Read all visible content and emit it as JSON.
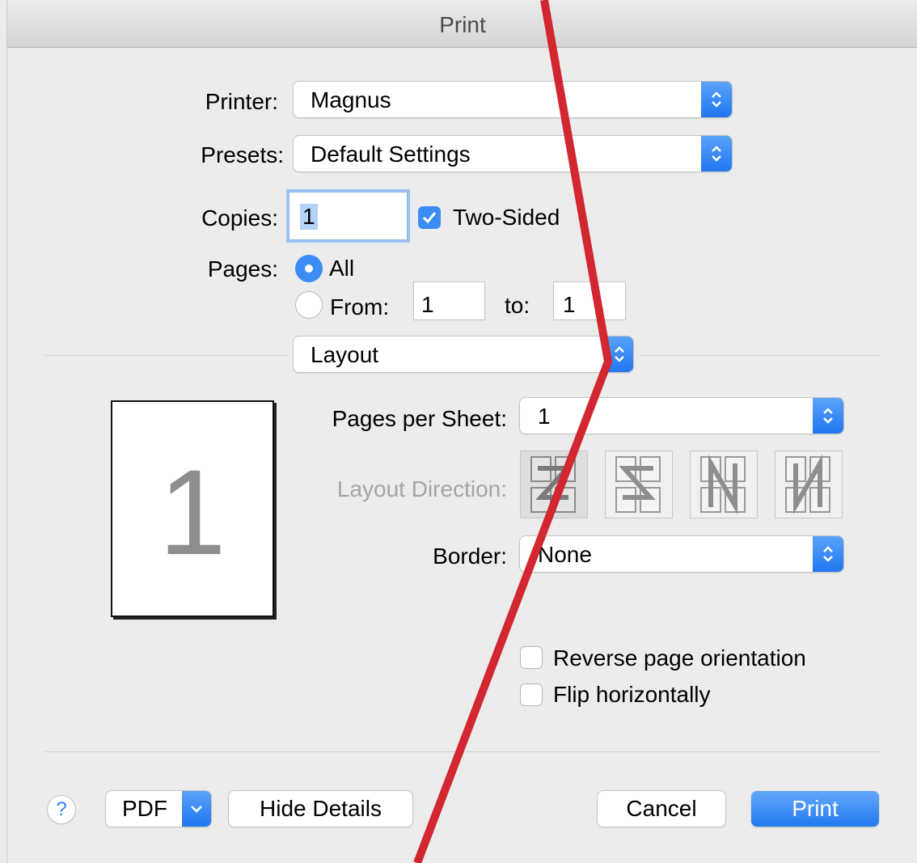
{
  "window": {
    "title": "Print"
  },
  "printer": {
    "label": "Printer:",
    "value": "Magnus"
  },
  "presets": {
    "label": "Presets:",
    "value": "Default Settings"
  },
  "copies": {
    "label": "Copies:",
    "value": "1",
    "two_sided_label": "Two-Sided",
    "two_sided_checked": true
  },
  "pages": {
    "label": "Pages:",
    "all_label": "All",
    "all_selected": true,
    "from_label": "From:",
    "from_value": "1",
    "to_label": "to:",
    "to_value": "1"
  },
  "section_popup": {
    "value": "Layout"
  },
  "preview": {
    "page_number": "1"
  },
  "layout": {
    "pages_per_sheet_label": "Pages per Sheet:",
    "pages_per_sheet_value": "1",
    "direction_label": "Layout Direction:",
    "direction_options": [
      "z-order-icon",
      "reverse-z-order-icon",
      "n-order-icon",
      "reverse-n-order-icon"
    ],
    "direction_selected": 0,
    "border_label": "Border:",
    "border_value": "None",
    "reverse_orientation_label": "Reverse page orientation",
    "reverse_orientation_checked": false,
    "flip_label": "Flip horizontally",
    "flip_checked": false
  },
  "footer": {
    "help_label": "?",
    "pdf_label": "PDF",
    "hide_details_label": "Hide Details",
    "cancel_label": "Cancel",
    "print_label": "Print"
  },
  "colors": {
    "accent": "#2f82f4",
    "annotation_line": "#d22630"
  }
}
